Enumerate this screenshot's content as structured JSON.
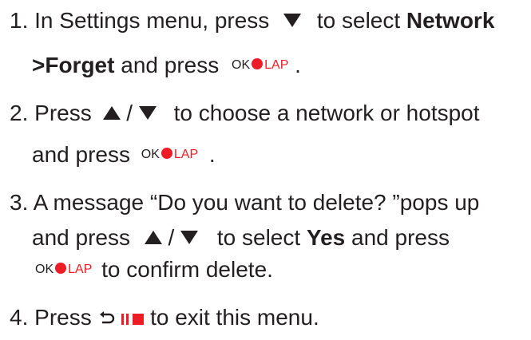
{
  "steps": [
    {
      "number": "1.",
      "line1_a": "In Settings menu, press",
      "line1_b": "to select",
      "line1_bold": "Network",
      "line2_bold": ">Forget",
      "line2_a": "and press",
      "line2_end": "."
    },
    {
      "number": "2.",
      "line1_a": "Press",
      "line1_slash": "/",
      "line1_b": "to choose a network or hotspot",
      "line2_a": "and press",
      "line2_end": "."
    },
    {
      "number": "3.",
      "line1": "A message “Do you want to delete? ”pops up",
      "line2_a": "and press",
      "line2_slash": "/",
      "line2_b": "to select",
      "line2_bold": "Yes",
      "line2_c": "and press",
      "line3_b": "to confirm delete."
    },
    {
      "number": "4.",
      "line1_a": "Press",
      "line1_b": "to exit this menu."
    }
  ],
  "ok_lap": {
    "ok": "OK",
    "lap": "LAP"
  },
  "icons": [
    "down-triangle-icon",
    "up-triangle-icon",
    "ok-lap-button-icon",
    "back-arrow-icon",
    "pause-stop-icon"
  ],
  "colors": {
    "text": "#231f20",
    "accent_red": "#ee1c25"
  }
}
